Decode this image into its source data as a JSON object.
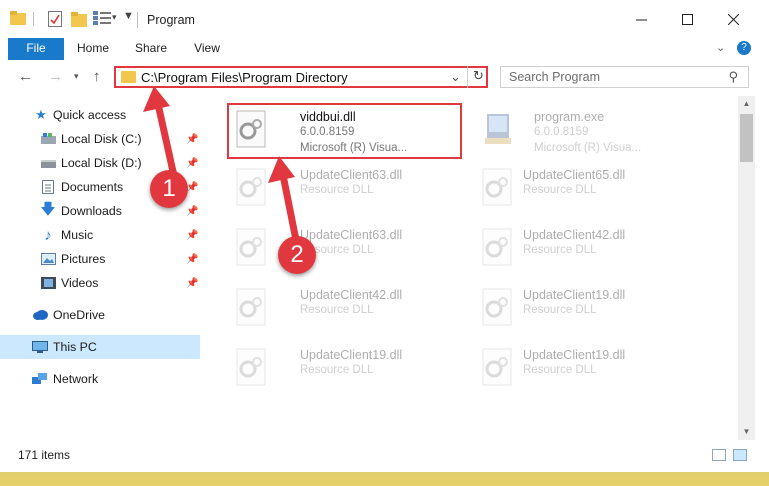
{
  "window": {
    "title": "Program"
  },
  "ribbon": {
    "tabs": [
      "File",
      "Home",
      "Share",
      "View"
    ]
  },
  "address": {
    "path": "C:\\Program Files\\Program Directory"
  },
  "search": {
    "placeholder": "Search Program"
  },
  "sidebar": {
    "items": [
      {
        "label": "Quick access",
        "icon": "star-icon"
      },
      {
        "label": "Local Disk (C:)",
        "icon": "drive-icon"
      },
      {
        "label": "Local Disk (D:)",
        "icon": "drive-icon"
      },
      {
        "label": "Documents",
        "icon": "documents-icon"
      },
      {
        "label": "Downloads",
        "icon": "download-icon"
      },
      {
        "label": "Music",
        "icon": "music-icon"
      },
      {
        "label": "Pictures",
        "icon": "pictures-icon"
      },
      {
        "label": "Videos",
        "icon": "videos-icon"
      },
      {
        "label": "OneDrive",
        "icon": "cloud-icon"
      },
      {
        "label": "This PC",
        "icon": "monitor-icon"
      },
      {
        "label": "Network",
        "icon": "network-icon"
      }
    ]
  },
  "files": [
    {
      "name": "viddbui.dll",
      "line1": "6.0.0.8159",
      "line2": "Microsoft (R) Visua..."
    },
    {
      "name": "program.exe",
      "line1": "6.0.0.8159",
      "line2": "Microsoft (R) Visua..."
    },
    {
      "name": "UpdateClient63.dll",
      "line1": "Resource DLL"
    },
    {
      "name": "UpdateClient65.dll",
      "line1": "Resource DLL"
    },
    {
      "name": "UpdateClient63.dll",
      "line1": "Resource DLL"
    },
    {
      "name": "UpdateClient42.dll",
      "line1": "Resource DLL"
    },
    {
      "name": "UpdateClient42.dll",
      "line1": "Resource DLL"
    },
    {
      "name": "UpdateClient19.dll",
      "line1": "Resource DLL"
    },
    {
      "name": "UpdateClient19.dll",
      "line1": "Resource DLL"
    },
    {
      "name": "UpdateClient19.dll",
      "line1": "Resource DLL"
    }
  ],
  "status": {
    "count": "171 items"
  },
  "annotations": {
    "badge1": "1",
    "badge2": "2"
  },
  "colors": {
    "accent": "#1979ca",
    "highlight": "#e0383e",
    "selected": "#cce8ff"
  }
}
